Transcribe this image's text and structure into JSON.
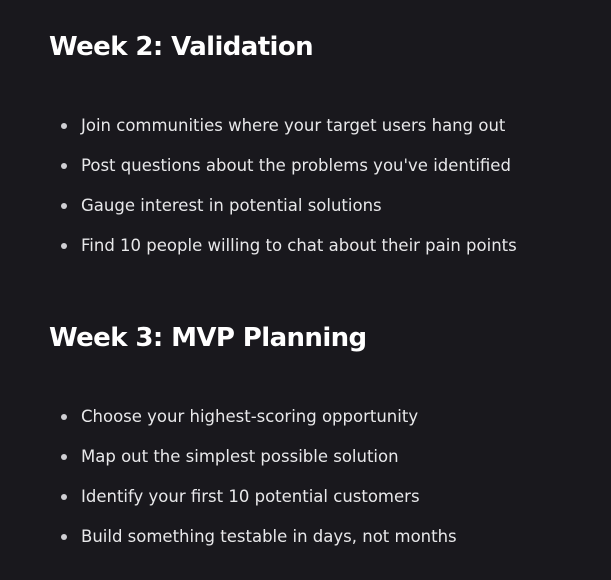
{
  "sections": [
    {
      "title": "Week 2: Validation",
      "items": [
        "Join communities where your target users hang out",
        "Post questions about the problems you've identified",
        "Gauge interest in potential solutions",
        "Find 10 people willing to chat about their pain points"
      ]
    },
    {
      "title": "Week 3: MVP Planning",
      "items": [
        "Choose your highest-scoring opportunity",
        "Map out the simplest possible solution",
        "Identify your first 10 potential customers",
        "Build something testable in days, not months"
      ]
    }
  ]
}
